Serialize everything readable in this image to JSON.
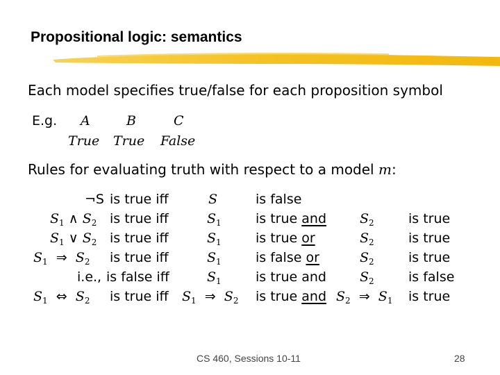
{
  "slide": {
    "title": "Propositional logic: semantics",
    "accent_color": "#F4BE17",
    "intro": "Each model specifies true/false for each proposition symbol",
    "example": {
      "label": "E.g.",
      "symbols": [
        "A",
        "B",
        "C"
      ],
      "values": [
        "True",
        "True",
        "False"
      ]
    },
    "rules_heading": "Rules for evaluating truth with respect to a model",
    "rules_heading_var": "m",
    "rules_heading_colon": ":",
    "rules": [
      {
        "lhs_a": "¬S",
        "lhs_b": "",
        "lhs_op": "",
        "cond": "is true iff",
        "x": "S",
        "x_op": "",
        "x2": "",
        "mid": "is false",
        "mid_conj": "",
        "y": "",
        "y_op": "",
        "y2": "",
        "end": ""
      },
      {
        "lhs_a": "S",
        "lhs_a_sub": "1",
        "lhs_op": "∧",
        "lhs_b": "S",
        "lhs_b_sub": "2",
        "cond": "is true iff",
        "x": "S",
        "x_sub": "1",
        "mid": "is true",
        "mid_conj": "and",
        "y": "S",
        "y_sub": "2",
        "end": "is true"
      },
      {
        "lhs_a": "S",
        "lhs_a_sub": "1",
        "lhs_op": "∨",
        "lhs_b": "S",
        "lhs_b_sub": "2",
        "cond": "is true iff",
        "x": "S",
        "x_sub": "1",
        "mid": "is true",
        "mid_conj": "or",
        "y": "S",
        "y_sub": "2",
        "end": "is true"
      },
      {
        "lhs_a": "S",
        "lhs_a_sub": "1",
        "lhs_op": "⇒",
        "lhs_b": "S",
        "lhs_b_sub": "2",
        "cond": "is true iff",
        "x": "S",
        "x_sub": "1",
        "mid": "is false",
        "mid_conj": "or",
        "y": "S",
        "y_sub": "2",
        "end": "is true"
      },
      {
        "lhs_text": "i.e.,",
        "cond": "is false iff",
        "x": "S",
        "x_sub": "1",
        "mid": "is true and",
        "y": "S",
        "y_sub": "2",
        "end": "is false"
      },
      {
        "lhs_a": "S",
        "lhs_a_sub": "1",
        "lhs_op": "⇔",
        "lhs_b": "S",
        "lhs_b_sub": "2",
        "cond": "is true iff",
        "x": "S",
        "x_sub": "1",
        "x_op": "⇒",
        "x2": "S",
        "x2_sub": "2",
        "mid": "is true",
        "mid_conj": "and",
        "y": "S",
        "y_sub": "2",
        "y_op": "⇒",
        "y2": "S",
        "y2_sub": "1",
        "end": "is true"
      }
    ]
  },
  "footer": {
    "course": "CS 460,  Sessions 10-11",
    "page_number": "28"
  }
}
